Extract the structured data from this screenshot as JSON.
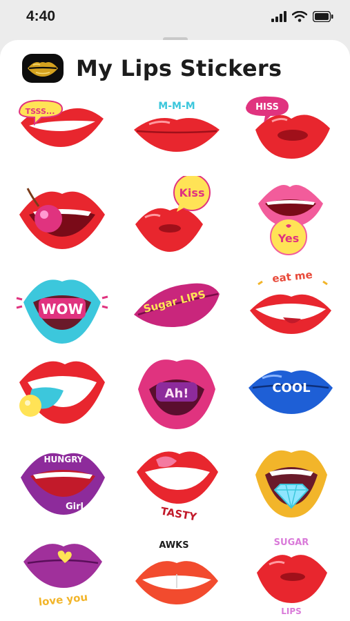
{
  "status": {
    "time": "4:40"
  },
  "header": {
    "title": "My Lips Stickers"
  },
  "stickers": [
    {
      "label": "TSSS..."
    },
    {
      "label": "M-M-M"
    },
    {
      "label": "HISS"
    },
    {
      "label": ""
    },
    {
      "label": "Kiss"
    },
    {
      "label": "Yes"
    },
    {
      "label": "WOW"
    },
    {
      "label": "Sugar LIPS"
    },
    {
      "label": "eat me"
    },
    {
      "label": ""
    },
    {
      "label": "Ah!"
    },
    {
      "label": "COOL"
    },
    {
      "label": "HUNGRY"
    },
    {
      "label": "TASTY"
    },
    {
      "label": ""
    },
    {
      "label": "love you"
    },
    {
      "label": "AWKS"
    },
    {
      "label": "SUGAR"
    }
  ],
  "extra_labels": {
    "girl": "Girl",
    "lips": "LIPS"
  },
  "colors": {
    "red": "#e8262e",
    "pink": "#e0337f",
    "cyan": "#3cc7dc",
    "blue": "#1e5fd6",
    "gold": "#f2b52a",
    "purple": "#8d2b9b"
  }
}
